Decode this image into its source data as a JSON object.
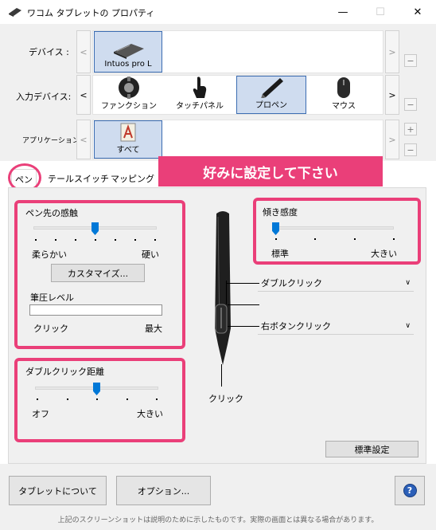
{
  "window": {
    "title": "ワコム タブレットの プロパティ",
    "minimize_icon": "—",
    "maximize_icon": "☐",
    "close_icon": "✕"
  },
  "devices": {
    "device_label": "デバイス :",
    "device_item": "Intuos pro L",
    "input_label": "入力デバイス:",
    "input_items": [
      "ファンクション",
      "タッチパネル",
      "プロペン",
      "マウス"
    ],
    "app_label": "アプリケーション :",
    "app_item": "すべて",
    "left_arrow": "<",
    "right_arrow": ">",
    "minus": "−",
    "plus": "+"
  },
  "tabs": [
    "ペン",
    "テールスイッチ",
    "マッピング"
  ],
  "banner": "好みに設定して下さい",
  "pen_tab": {
    "tip_feel": {
      "title": "ペン先の感触",
      "left": "柔らかい",
      "right": "硬い",
      "value": 0.5
    },
    "customize_button": "カスタマイズ...",
    "pressure": {
      "label": "筆圧レベル",
      "left": "クリック",
      "right": "最大"
    },
    "double_click": {
      "title": "ダブルクリック距離",
      "left": "オフ",
      "right": "大きい",
      "value": 0.5
    },
    "tilt": {
      "title": "傾き感度",
      "left": "標準",
      "right": "大きい",
      "value": 0.0
    },
    "side_switch_upper": "ダブルクリック",
    "side_switch_lower": "右ボタンクリック",
    "pen_tip_label": "クリック",
    "default_button": "標準設定"
  },
  "footer": {
    "about_button": "タブレットについて",
    "options_button": "オプション...",
    "help_icon": "?",
    "note": "上記のスクリーンショットは説明のために示したものです。実際の画面とは異なる場合があります。"
  },
  "colors": {
    "accent": "#0078d7",
    "highlight": "#ea3f79",
    "selected_tile": "#cfdcef"
  }
}
